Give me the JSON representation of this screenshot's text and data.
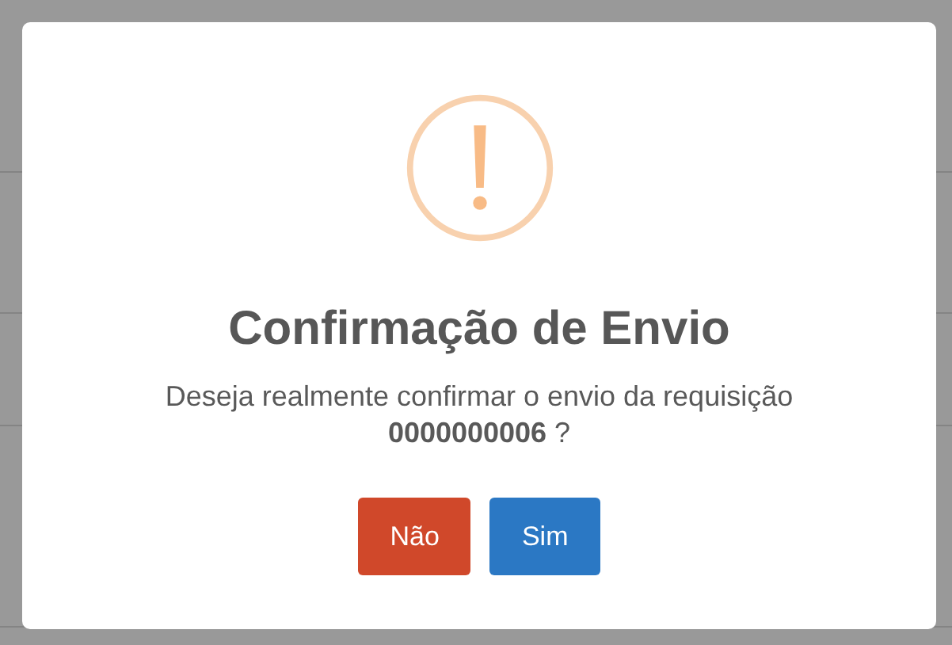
{
  "dialog": {
    "title": "Confirmação de Envio",
    "message": "Deseja realmente confirmar o envio da requisição",
    "reference": "**0000000006** ?",
    "buttons": [
      {
        "label": "Não",
        "kind": "cancel"
      },
      {
        "label": "Sim",
        "kind": "confirm"
      }
    ]
  }
}
